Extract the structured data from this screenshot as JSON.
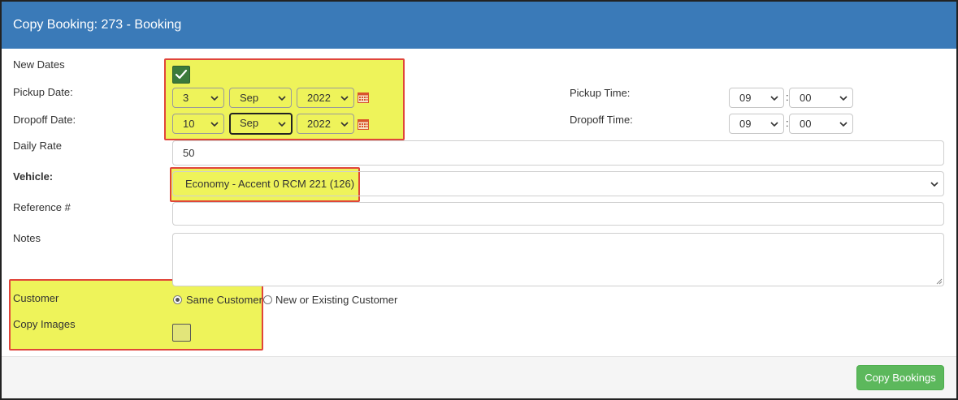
{
  "dialog": {
    "title": "Copy Booking: 273 - Booking"
  },
  "form": {
    "new_dates_label": "New Dates",
    "new_dates_checked": true,
    "pickup_date_label": "Pickup Date:",
    "pickup_day": "3",
    "pickup_month": "Sep",
    "pickup_year": "2022",
    "pickup_time_label": "Pickup Time:",
    "pickup_hour": "09",
    "pickup_minute": "00",
    "dropoff_date_label": "Dropoff Date:",
    "dropoff_day": "10",
    "dropoff_month": "Sep",
    "dropoff_year": "2022",
    "dropoff_time_label": "Dropoff Time:",
    "dropoff_hour": "09",
    "dropoff_minute": "00",
    "time_separator": ":",
    "daily_rate_label": "Daily Rate",
    "daily_rate_value": "50",
    "vehicle_label": "Vehicle:",
    "vehicle_value": "Economy - Accent 0 RCM 221 (126)",
    "reference_label": "Reference #",
    "reference_value": "",
    "notes_label": "Notes",
    "notes_value": "",
    "customer_label": "Customer",
    "customer_options": [
      "Same Customer",
      "New or Existing Customer"
    ],
    "customer_selected": "Same Customer",
    "copy_images_label": "Copy Images",
    "copy_images_checked": false
  },
  "footer": {
    "copy_button_label": "Copy Bookings"
  },
  "colors": {
    "header": "#3a7ab8",
    "highlight": "#eef35a",
    "highlight_border": "#e0453a",
    "button_green": "#5cb85c",
    "checkbox_green": "#3b7a3b"
  },
  "icons": {
    "calendar": "calendar-icon",
    "caret": "chevron-down-icon",
    "check": "check-icon"
  }
}
